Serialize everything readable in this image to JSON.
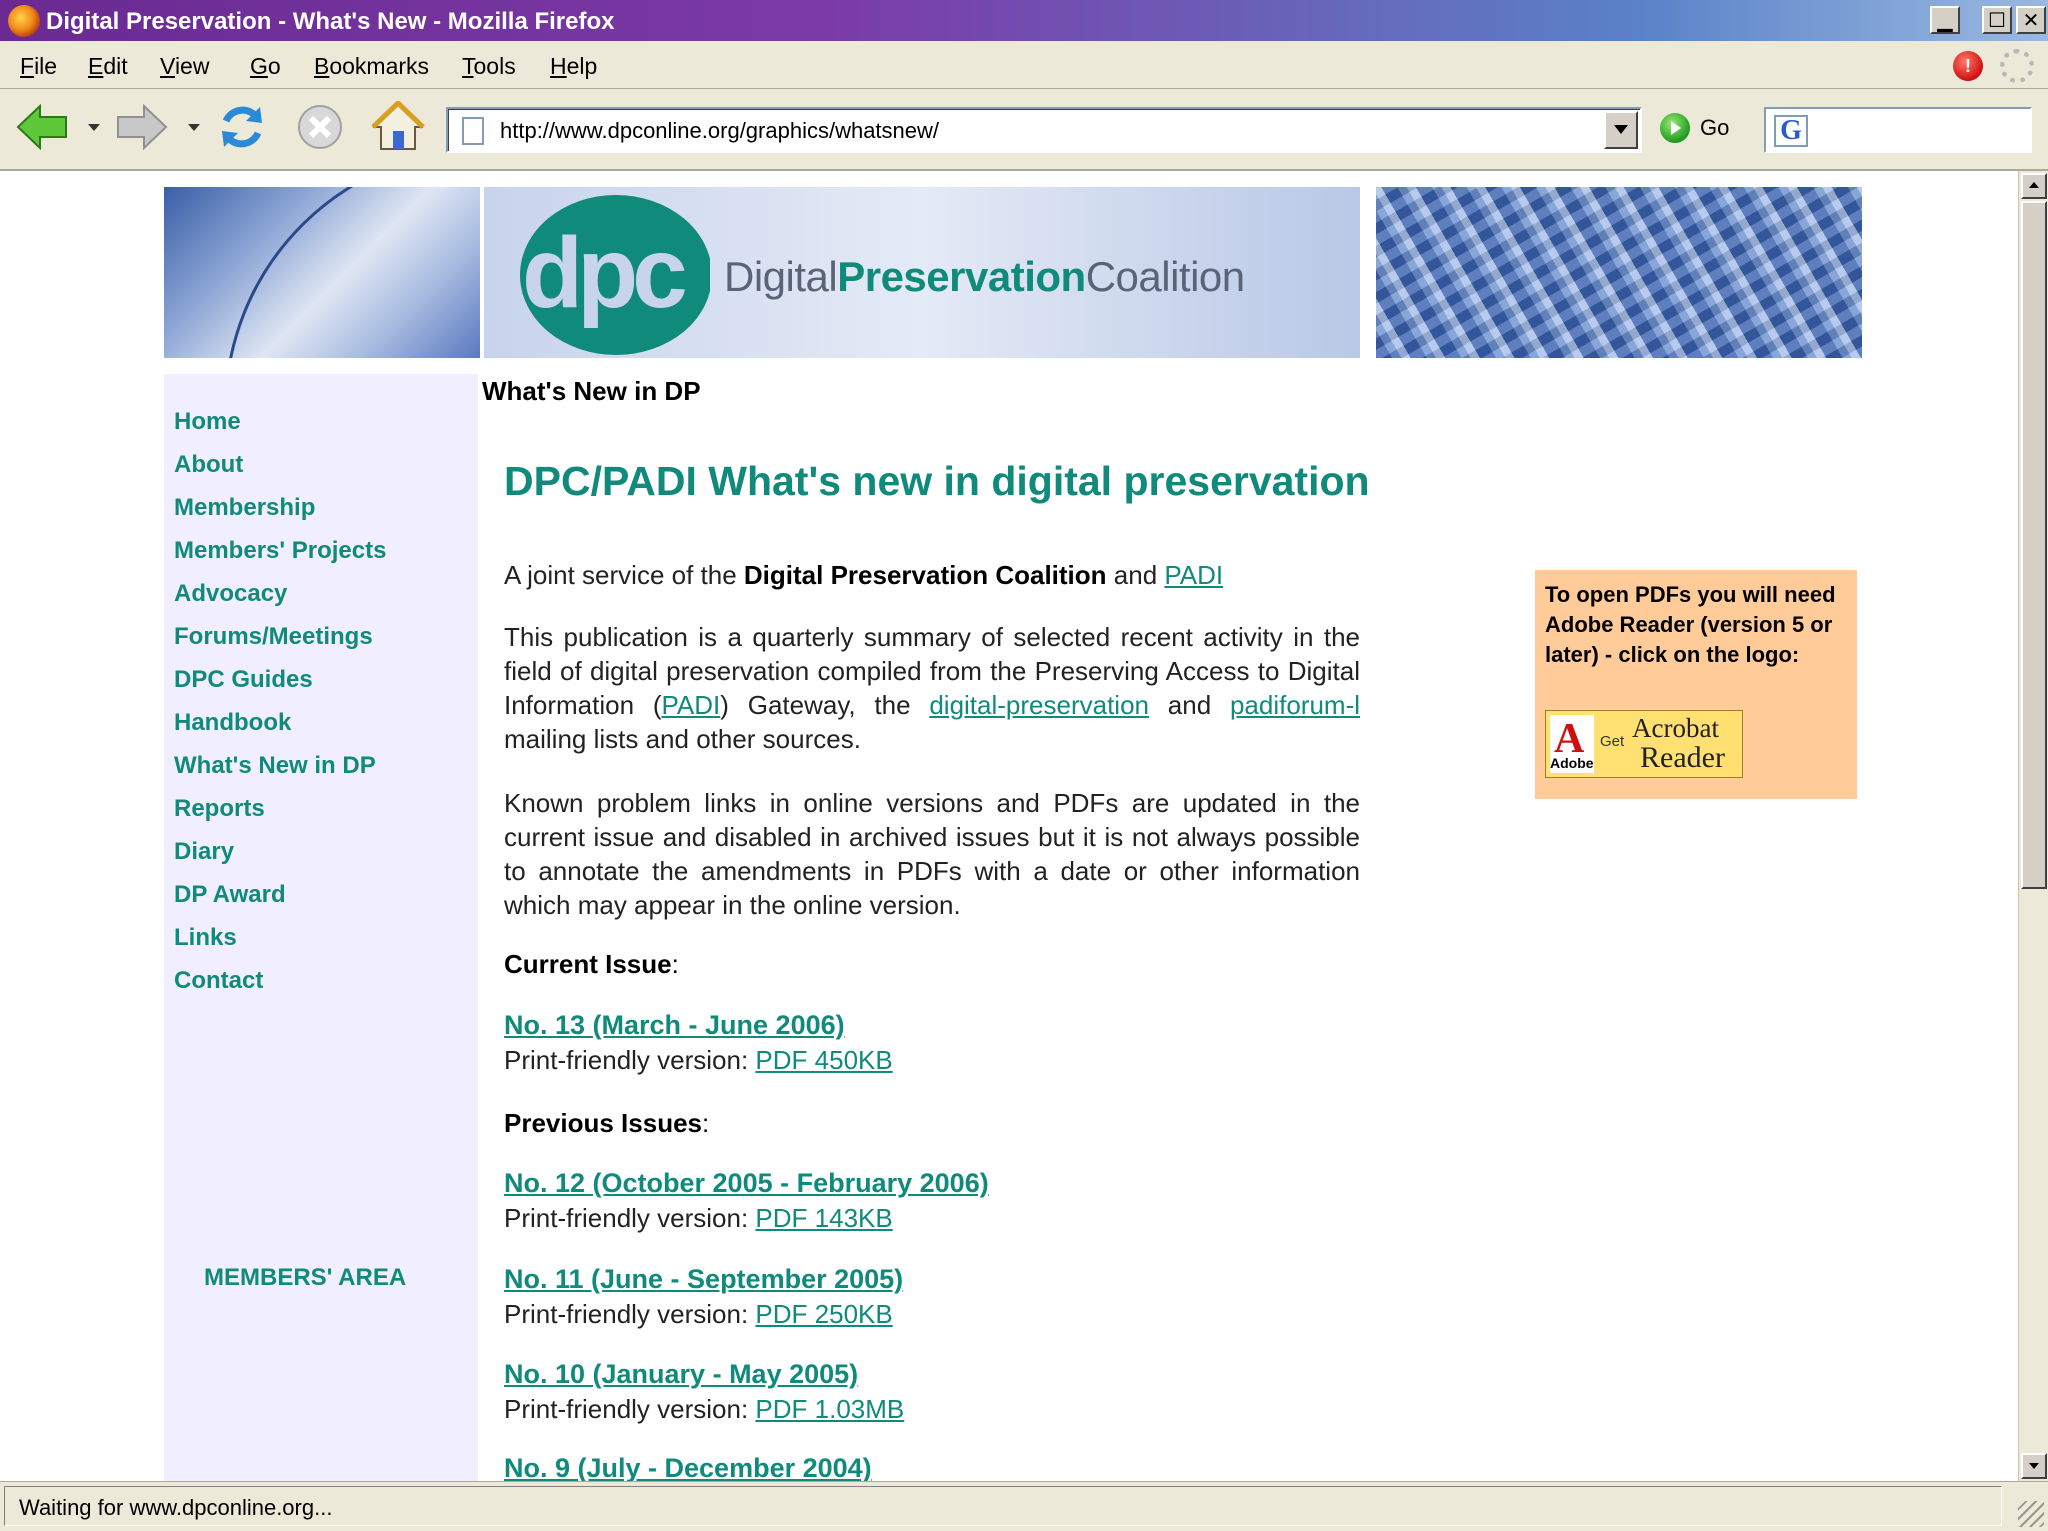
{
  "window": {
    "title": "Digital Preservation - What's New - Mozilla Firefox",
    "min_glyph": "▁",
    "max_glyph": "☐",
    "close_glyph": "✕"
  },
  "menu": [
    {
      "label": "File",
      "accel": "F",
      "rest": "ile"
    },
    {
      "label": "Edit",
      "accel": "E",
      "rest": "dit"
    },
    {
      "label": "View",
      "accel": "V",
      "rest": "iew"
    },
    {
      "label": "Go",
      "accel": "G",
      "rest": "o"
    },
    {
      "label": "Bookmarks",
      "accel": "B",
      "rest": "ookmarks"
    },
    {
      "label": "Tools",
      "accel": "T",
      "rest": "ools"
    },
    {
      "label": "Help",
      "accel": "H",
      "rest": "elp"
    }
  ],
  "toolbar": {
    "url": "http://www.dpconline.org/graphics/whatsnew/",
    "go_label": "Go",
    "search_engine_glyph": "G",
    "alert_glyph": "!"
  },
  "banner": {
    "logo_word_1": "Digital",
    "logo_word_2": "Preservation",
    "logo_word_3": "Coalition",
    "logo_letters": "dpc"
  },
  "sidebar": {
    "items": [
      "Home",
      "About",
      "Membership",
      "Members' Projects",
      "Advocacy",
      "Forums/Meetings",
      "DPC Guides",
      "Handbook",
      "What's New in DP",
      "Reports",
      "Diary",
      "DP Award",
      "Links",
      "Contact"
    ],
    "members_area": "MEMBERS' AREA"
  },
  "page": {
    "section_label": "What's New in DP",
    "title": "DPC/PADI What's new in digital preservation",
    "intro_prefix": "A joint service of the ",
    "intro_strong": "Digital Preservation Coalition",
    "intro_and": " and ",
    "intro_link": "PADI",
    "p1_a": "This publication is a quarterly summary of selected recent activity in the field of digital preservation compiled from the Preserving Access to Digital Information (",
    "p1_link1": "PADI",
    "p1_b": ") Gateway, the ",
    "p1_link2": "digital-preservation",
    "p1_c": " and ",
    "p1_link3": "padiforum-l",
    "p1_d": " mailing lists and other sources.",
    "p2": "Known problem links in online versions and PDFs are updated in the current issue and disabled in archived issues but it is not always possible to annotate the amendments in PDFs with a date or other information which may appear in the online version.",
    "current_heading": "Current Issue",
    "previous_heading": "Previous Issues",
    "colon": ":",
    "print_prefix": "Print-friendly version: ",
    "current_issue": {
      "title": "No. 13 (March - June 2006)",
      "pdf": "PDF 450KB"
    },
    "previous_issues": [
      {
        "title": "No. 12 (October 2005 - February 2006)",
        "pdf": "PDF 143KB"
      },
      {
        "title": "No. 11 (June - September 2005)",
        "pdf": "PDF 250KB"
      },
      {
        "title": "No. 10 (January - May 2005)",
        "pdf": "PDF 1.03MB"
      },
      {
        "title": "No. 9 (July - December 2004)"
      }
    ]
  },
  "pdf_box": {
    "text": "To open PDFs you will need Adobe Reader (version 5 or later) - click on the logo:",
    "logo_a": "A",
    "logo_adobe": "Adobe",
    "logo_get": "Get",
    "logo_acrobat": "Acrobat",
    "logo_reader": "Reader"
  },
  "status": {
    "text": "Waiting for www.dpconline.org..."
  },
  "colors": {
    "accent_teal": "#108a7a",
    "sidebar_bg": "#f1eeff",
    "pdf_box_bg": "#ffcc99"
  }
}
